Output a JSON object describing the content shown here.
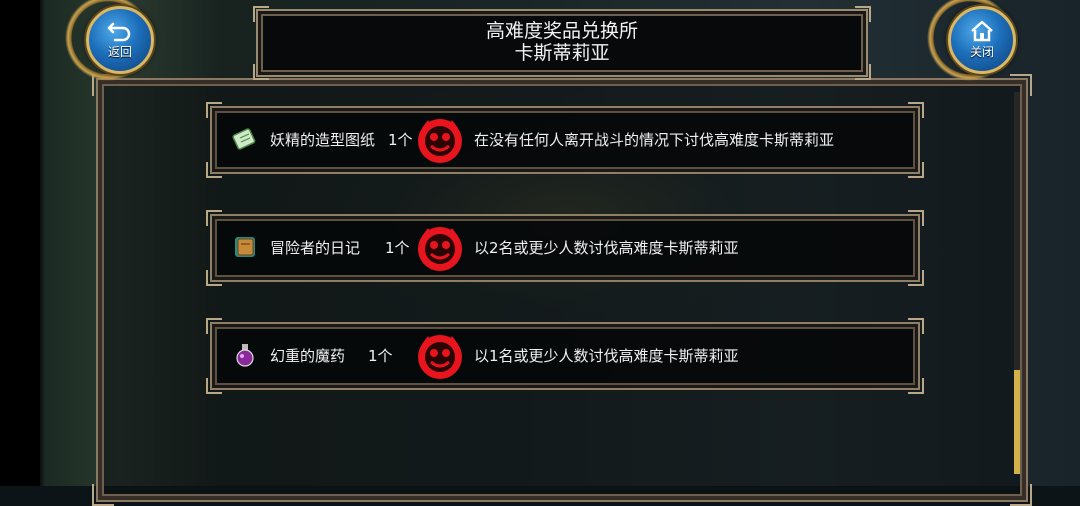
{
  "header": {
    "title": "高难度奖品兑换所",
    "subtitle": "卡斯蒂莉亚"
  },
  "buttons": {
    "back_label": "返回",
    "close_label": "关闭"
  },
  "quests": [
    {
      "item": "妖精的造型图纸",
      "count": "1个",
      "item_icon": "blueprint-icon",
      "condition": "在没有任何人离开战斗的情况下讨伐高难度卡斯蒂莉亚"
    },
    {
      "item": "冒险者的日记",
      "count": "1个",
      "item_icon": "diary-book-icon",
      "condition": "以2名或更少人数讨伐高难度卡斯蒂莉亚"
    },
    {
      "item": "幻重的魔药",
      "count": "1个",
      "item_icon": "potion-icon",
      "condition": "以1名或更少人数讨伐高难度卡斯蒂莉亚"
    }
  ],
  "colors": {
    "boss_icon_red": "#e8141e",
    "button_blue": "#1d6fbb",
    "frame_gold": "#b9a888",
    "scroll_thumb": "#d2b24b"
  }
}
